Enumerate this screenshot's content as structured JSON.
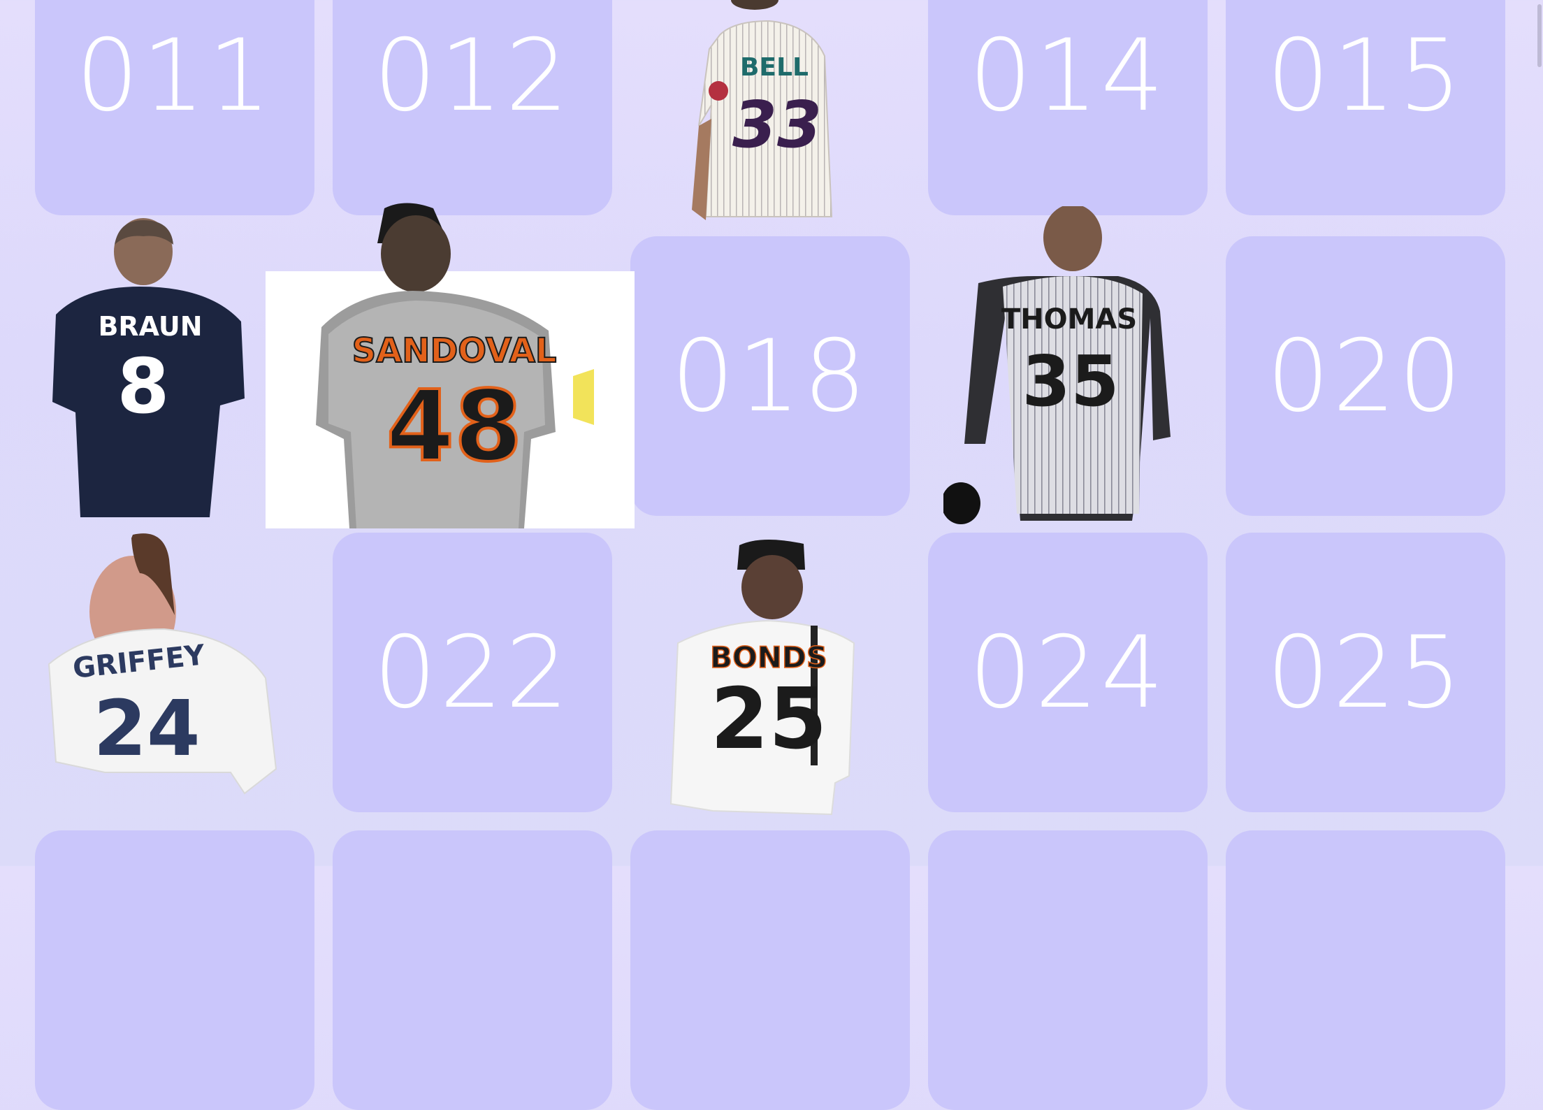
{
  "tiles": {
    "t011": "011",
    "t012": "012",
    "t014": "014",
    "t015": "015",
    "t018": "018",
    "t020": "020",
    "t022": "022",
    "t024": "024",
    "t025": "025"
  },
  "players": {
    "bell": {
      "name": "BELL",
      "number": "33"
    },
    "braun": {
      "name": "BRAUN",
      "number": "8"
    },
    "sandoval": {
      "name": "SANDOVAL",
      "number": "48"
    },
    "thomas": {
      "name": "THOMAS",
      "number": "35"
    },
    "griffey": {
      "name": "GRIFFEY",
      "number": "24"
    },
    "bonds": {
      "name": "BONDS",
      "number": "25"
    }
  },
  "colors": {
    "background": "#e0dcfb",
    "tile": "#cac6fb",
    "tile_text": "#ffffff"
  }
}
